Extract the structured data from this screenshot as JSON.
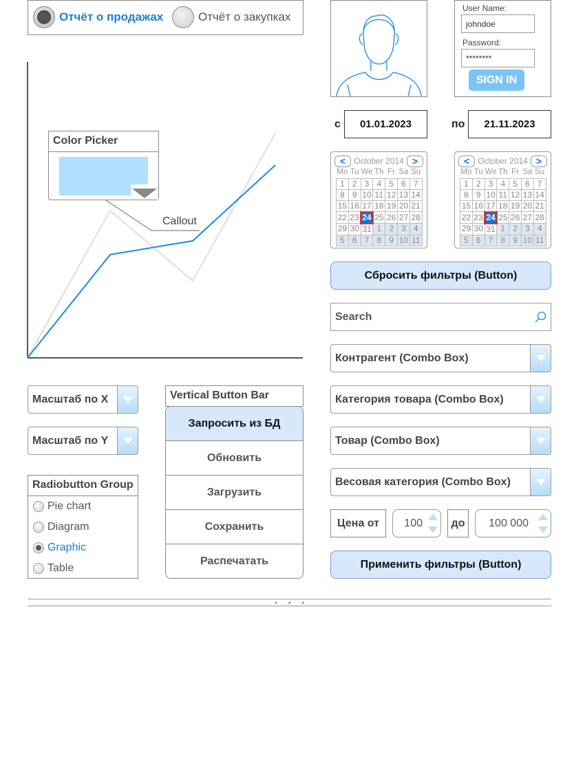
{
  "report_tabs": [
    {
      "label": "Отчёт о продажах",
      "selected": true,
      "color": "#1a7fd8"
    },
    {
      "label": "Отчёт о закупках",
      "selected": false,
      "color": "#555555"
    }
  ],
  "chart": {
    "color_picker_title": "Color Picker",
    "color_picker_value": "#aee0ff",
    "callout_label": "Callout"
  },
  "chart_data": {
    "type": "line",
    "x": [
      0,
      1,
      2,
      3
    ],
    "series": [
      {
        "values": [
          0,
          37.5,
          42.5,
          70
        ],
        "color": "#1a8ae6"
      },
      {
        "values": [
          0,
          53.5,
          28,
          81.5
        ],
        "color": "#dddddd"
      }
    ],
    "ylim": [
      0,
      100
    ]
  },
  "scale_x": {
    "label": "Масштаб по X"
  },
  "scale_y": {
    "label": "Масштаб по Y"
  },
  "radio_group": {
    "title": "Radiobutton Group",
    "items": [
      {
        "label": "Pie chart",
        "selected": false
      },
      {
        "label": "Diagram",
        "selected": false
      },
      {
        "label": "Graphic",
        "selected": true
      },
      {
        "label": "Table",
        "selected": false
      }
    ]
  },
  "button_bar": {
    "title": "Vertical Button Bar",
    "buttons": [
      "Запросить из БД",
      "Обновить",
      "Загрузить",
      "Сохранить",
      "Распечатать"
    ]
  },
  "login": {
    "username_label": "User Name:",
    "username_value": "johndoe",
    "password_label": "Password:",
    "password_value": "********",
    "signin_label": "SIGN IN"
  },
  "date_range": {
    "from_label": "с",
    "from_value": "01.01.2023",
    "to_label": "по",
    "to_value": "21.11.2023"
  },
  "calendars": [
    {
      "month": "October 2014",
      "selected_day": "24"
    },
    {
      "month": "October 2014",
      "selected_day": "24"
    }
  ],
  "calendar_weekdays": [
    "Mo",
    "Tu",
    "We",
    "Th",
    "Fr",
    "Sa",
    "Su"
  ],
  "calendar_weeks": [
    [
      "1",
      "2",
      "3",
      "4",
      "5",
      "6",
      "7"
    ],
    [
      "8",
      "9",
      "10",
      "11",
      "12",
      "13",
      "14"
    ],
    [
      "15",
      "16",
      "17",
      "18",
      "19",
      "20",
      "21"
    ],
    [
      "22",
      "23",
      "24",
      "25",
      "26",
      "27",
      "28"
    ],
    [
      "29",
      "30",
      "31",
      "1",
      "2",
      "3",
      "4"
    ],
    [
      "5",
      "6",
      "7",
      "8",
      "9",
      "10",
      "11"
    ]
  ],
  "reset_button": "Сбросить фильтры (Button)",
  "search": {
    "placeholder": "Search"
  },
  "combos": [
    "Контрагент (Combo Box)",
    "Категория товара (Combo Box)",
    "Товар (Combo Box)",
    "Весовая категория (Combo Box)"
  ],
  "price": {
    "from_label": "Цена от",
    "from_value": "100",
    "to_label": "до",
    "to_value": "100 000"
  },
  "apply_button": "Применить фильтры (Button)",
  "pager_dots": "• • •"
}
